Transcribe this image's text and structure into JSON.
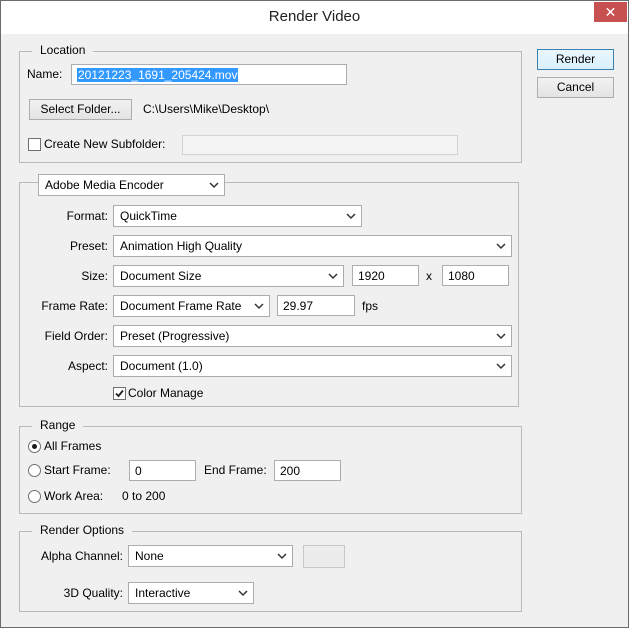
{
  "window": {
    "title": "Render Video",
    "close_glyph": "✕"
  },
  "buttons": {
    "render": "Render",
    "cancel": "Cancel"
  },
  "location": {
    "legend": "Location",
    "name_label": "Name:",
    "name_value": "20121223_1691_205424.mov",
    "select_folder": "Select Folder...",
    "folder_path": "C:\\Users\\Mike\\Desktop\\",
    "create_subfolder_label": "Create New Subfolder:",
    "create_subfolder_checked": false,
    "subfolder_value": ""
  },
  "encoder": {
    "renderer": "Adobe Media Encoder",
    "format_label": "Format:",
    "format": "QuickTime",
    "preset_label": "Preset:",
    "preset": "Animation High Quality",
    "size_label": "Size:",
    "size": "Document Size",
    "width": "1920",
    "x_sep": "x",
    "height": "1080",
    "frame_rate_label": "Frame Rate:",
    "frame_rate_mode": "Document Frame Rate",
    "frame_rate": "29.97",
    "fps_label": "fps",
    "field_order_label": "Field Order:",
    "field_order": "Preset (Progressive)",
    "aspect_label": "Aspect:",
    "aspect": "Document (1.0)",
    "color_manage_label": "Color Manage",
    "color_manage_checked": true
  },
  "range": {
    "legend": "Range",
    "all_frames_label": "All Frames",
    "start_frame_label": "Start Frame:",
    "start_frame": "0",
    "end_frame_label": "End Frame:",
    "end_frame": "200",
    "work_area_label": "Work Area:",
    "work_area_value": "0 to 200",
    "selected": "All Frames"
  },
  "render_options": {
    "legend": "Render Options",
    "alpha_label": "Alpha Channel:",
    "alpha": "None",
    "quality_label": "3D Quality:",
    "quality": "Interactive"
  },
  "colors": {
    "accent": "#3399ff",
    "close": "#c75050",
    "default_border": "#3c7fb1"
  }
}
